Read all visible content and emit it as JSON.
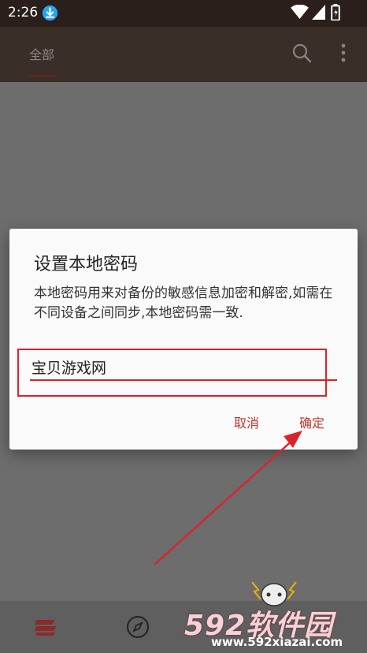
{
  "status_bar": {
    "time": "2:26"
  },
  "app_bar": {
    "tab_all": "全部"
  },
  "dialog": {
    "title": "设置本地密码",
    "message": "本地密码用来对备份的敏感信息加密和解密,如需在不同设备之间同步,本地密码需一致.",
    "password_value": "宝贝游戏网",
    "cancel_label": "取消",
    "confirm_label": "确定"
  },
  "watermark": {
    "brand": "592软件园",
    "url": "www.592xiazai.com"
  },
  "colors": {
    "accent": "#c2362f",
    "annotation_red": "#d8252d",
    "appbar": "#3a2e29"
  },
  "icons": [
    "download-icon",
    "wifi-icon",
    "signal-icon",
    "battery-icon",
    "search-icon",
    "more-vert-icon",
    "home-icon",
    "compass-icon"
  ]
}
